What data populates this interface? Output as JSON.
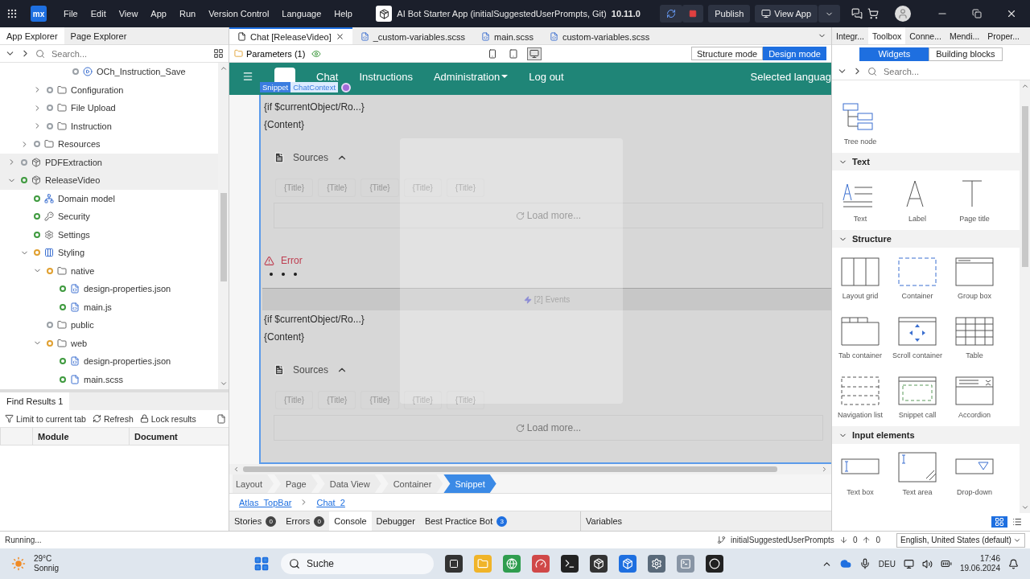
{
  "titlebar": {
    "logo": "mx",
    "menus": [
      "File",
      "Edit",
      "View",
      "App",
      "Run",
      "Version Control",
      "Language",
      "Help"
    ],
    "title": "AI Bot Starter App (initialSuggestedUserPrompts, Git)",
    "version": "10.11.0",
    "publish": "Publish",
    "view_app": "View App"
  },
  "left_tabs": [
    {
      "label": "App Explorer",
      "selected": true
    },
    {
      "label": "Page Explorer",
      "selected": false
    }
  ],
  "explorer_search": {
    "placeholder": "Search..."
  },
  "tree": [
    {
      "children": [
        {
          "children": [
            {
              "children": [
                {
                  "children": [
                    {
                      "label": "OCh_Instruction_Save",
                      "kind": "microflow",
                      "color": "#9aa0a6",
                      "selected": false
                    }
                  ]
                }
              ]
            },
            {
              "label": "Configuration",
              "kind": "folder",
              "color": "#9aa0a6",
              "expanded": false,
              "selected": false
            },
            {
              "label": "File Upload",
              "kind": "folder",
              "color": "#9aa0a6",
              "expanded": false,
              "selected": false
            },
            {
              "label": "Instruction",
              "kind": "folder",
              "color": "#9aa0a6",
              "expanded": false,
              "selected": false
            }
          ]
        },
        {
          "label": "Resources",
          "kind": "folder",
          "color": "#9aa0a6",
          "expanded": false,
          "selected": false
        }
      ]
    },
    {
      "label": "PDFExtraction",
      "kind": "module",
      "color": "#9aa0a6",
      "expanded": false,
      "selected": true
    },
    {
      "label": "ReleaseVideo",
      "kind": "module",
      "color": "#3f9a3f",
      "expanded": true,
      "selected": true,
      "children": [
        {
          "label": "Domain model",
          "kind": "domain",
          "color": "#3f9a3f",
          "selected": false
        },
        {
          "label": "Security",
          "kind": "security",
          "color": "#3f9a3f",
          "selected": false
        },
        {
          "label": "Settings",
          "kind": "settings",
          "color": "#3f9a3f",
          "selected": false
        },
        {
          "label": "Styling",
          "kind": "styling",
          "color": "#e0a030",
          "expanded": true,
          "selected": false,
          "children": [
            {
              "label": "native",
              "kind": "folder",
              "color": "#e0a030",
              "expanded": true,
              "selected": false,
              "children": [
                {
                  "label": "design-properties.json",
                  "kind": "json",
                  "color": "#3f9a3f",
                  "selected": false
                },
                {
                  "label": "main.js",
                  "kind": "js",
                  "color": "#3f9a3f",
                  "selected": false
                }
              ]
            },
            {
              "label": "public",
              "kind": "folder",
              "color": "#9aa0a6",
              "selected": false
            },
            {
              "label": "web",
              "kind": "folder",
              "color": "#e0a030",
              "expanded": true,
              "selected": false,
              "children": [
                {
                  "label": "design-properties.json",
                  "kind": "json",
                  "color": "#3f9a3f",
                  "selected": false
                },
                {
                  "label": "main.scss",
                  "kind": "scss",
                  "color": "#3f9a3f",
                  "selected": false
                }
              ]
            }
          ]
        }
      ]
    }
  ],
  "find_results": {
    "tab": "Find Results 1",
    "tools": [
      {
        "label": "Limit to current tab",
        "kind": "filter"
      },
      {
        "label": "Refresh",
        "kind": "refresh"
      },
      {
        "label": "Lock results",
        "kind": "lock"
      }
    ],
    "columns": [
      "Module",
      "Document"
    ]
  },
  "doc_tabs": [
    {
      "label": "Chat [ReleaseVideo]",
      "kind": "page",
      "selected": true
    },
    {
      "label": "_custom-variables.scss",
      "kind": "scss",
      "selected": false
    },
    {
      "label": "main.scss",
      "kind": "scss",
      "selected": false
    },
    {
      "label": "custom-variables.scss",
      "kind": "scss",
      "selected": false
    }
  ],
  "parameters": "Parameters (1)",
  "devices": [
    {
      "kind": "phone",
      "selected": false
    },
    {
      "kind": "tablet",
      "selected": false
    },
    {
      "kind": "desktop",
      "selected": true
    }
  ],
  "modes": [
    {
      "label": "Structure mode",
      "selected": false
    },
    {
      "label": "Design mode",
      "selected": true
    }
  ],
  "canvas": {
    "nav": [
      {
        "label": "Chat",
        "dropdown": false
      },
      {
        "label": "Instructions",
        "dropdown": false
      },
      {
        "label": "Administration",
        "dropdown": true
      },
      {
        "label": "Log out",
        "dropdown": false
      }
    ],
    "language": "Selected languag",
    "badges": [
      "Snippet",
      "ChatContext"
    ],
    "blocks": [
      {
        "kind": "text",
        "text": "{if $currentObject/Ro...}"
      },
      {
        "kind": "text",
        "text": "{Content}"
      },
      {
        "kind": "sources",
        "text": "Sources"
      },
      {
        "kind": "titles",
        "items": [
          "{Title}",
          "{Title}",
          "{Title}",
          "{Title}",
          "{Title}"
        ]
      },
      {
        "kind": "load",
        "text": "Load more..."
      },
      {
        "kind": "error",
        "text": "Error"
      },
      {
        "kind": "dots"
      },
      {
        "kind": "events",
        "text": "[2] Events"
      },
      {
        "kind": "text",
        "text": "{if $currentObject/Ro...}"
      },
      {
        "kind": "text",
        "text": "{Content}"
      },
      {
        "kind": "sources",
        "text": "Sources"
      },
      {
        "kind": "titles",
        "items": [
          "{Title}",
          "{Title}",
          "{Title}",
          "{Title}",
          "{Title}"
        ]
      },
      {
        "kind": "load",
        "text": "Load more..."
      }
    ]
  },
  "breadcrumb": [
    {
      "label": "Layout",
      "selected": false
    },
    {
      "label": "Page",
      "selected": false
    },
    {
      "label": "Data View",
      "selected": false
    },
    {
      "label": "Container",
      "selected": false
    },
    {
      "label": "Snippet",
      "selected": true
    }
  ],
  "links": [
    "Atlas_TopBar",
    "Chat_2"
  ],
  "bottom_tabs": [
    {
      "label": "Stories",
      "count": "0",
      "selected": false
    },
    {
      "label": "Errors",
      "count": "0",
      "selected": false
    },
    {
      "label": "Console",
      "selected": true
    },
    {
      "label": "Debugger",
      "selected": false
    },
    {
      "label": "Best Practice Bot",
      "count": "3",
      "selected": false
    }
  ],
  "variables_tab": "Variables",
  "right_tabs": [
    {
      "label": "Integr...",
      "selected": false
    },
    {
      "label": "Toolbox",
      "selected": true
    },
    {
      "label": "Conne...",
      "selected": false
    },
    {
      "label": "Mendi...",
      "selected": false
    },
    {
      "label": "Proper...",
      "selected": false
    }
  ],
  "toolbox_modes": [
    {
      "label": "Widgets",
      "selected": true
    },
    {
      "label": "Building blocks",
      "selected": false
    }
  ],
  "toolbox_search": {
    "placeholder": "Search..."
  },
  "widget_sections": [
    {
      "widgets": [
        {
          "label": "Tree node",
          "kind": "tree"
        }
      ]
    },
    {
      "title": "Text",
      "expanded": true,
      "widgets": [
        {
          "label": "Text",
          "kind": "text"
        },
        {
          "label": "Label",
          "kind": "label"
        },
        {
          "label": "Page title",
          "kind": "title"
        }
      ]
    },
    {
      "title": "Structure",
      "expanded": true,
      "widgets": [
        {
          "label": "Layout grid",
          "kind": "grid"
        },
        {
          "label": "Container",
          "kind": "container"
        },
        {
          "label": "Group box",
          "kind": "groupbox"
        },
        {
          "label": "Tab container",
          "kind": "tabs"
        },
        {
          "label": "Scroll container",
          "kind": "scroll"
        },
        {
          "label": "Table",
          "kind": "table"
        },
        {
          "label": "Navigation list",
          "kind": "navlist"
        },
        {
          "label": "Snippet call",
          "kind": "snippet"
        },
        {
          "label": "Accordion",
          "kind": "accordion"
        }
      ]
    },
    {
      "title": "Input elements",
      "expanded": true,
      "widgets": [
        {
          "label": "Text box",
          "kind": "textbox"
        },
        {
          "label": "Text area",
          "kind": "textarea"
        },
        {
          "label": "Drop-down",
          "kind": "dropdown"
        }
      ]
    }
  ],
  "view_toggle": [
    {
      "kind": "grid",
      "selected": true
    },
    {
      "kind": "list",
      "selected": false
    }
  ],
  "status": {
    "text": "Running...",
    "branch": "initialSuggestedUserPrompts",
    "incoming": "0",
    "outgoing": "0",
    "language": "English, United States (default)"
  },
  "taskbar": {
    "temperature": "29°C",
    "weather": "Sonnig",
    "search": "Suche",
    "keyboard": "DEU",
    "time": "17:46",
    "date": "19.06.2024"
  }
}
